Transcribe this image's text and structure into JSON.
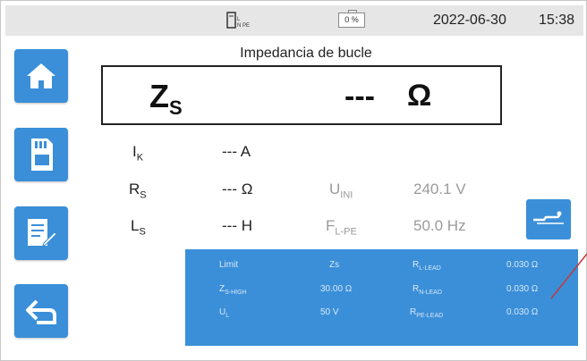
{
  "status": {
    "battery_text": "0 %",
    "date": "2022-06-30",
    "time": "15:38"
  },
  "title": "Impedancia de bucle",
  "main_result": {
    "symbol_main": "Z",
    "symbol_sub": "S",
    "value": "---",
    "unit": "Ω"
  },
  "readings": [
    {
      "sym": "I",
      "sub": "K",
      "value": "--- A"
    },
    {
      "sym": "R",
      "sub": "S",
      "value": "--- Ω"
    },
    {
      "sym": "L",
      "sub": "S",
      "value": "--- H"
    }
  ],
  "measurements": [
    {
      "sym": "U",
      "sub": "INI",
      "value": "240.1 V"
    },
    {
      "sym": "F",
      "sub": "L-PE",
      "value": "50.0 Hz"
    }
  ],
  "settings": {
    "rows": [
      {
        "c1": "Limit",
        "c1sub": "",
        "c2": "Zs",
        "c3": "R",
        "c3sub": "L-LEAD",
        "c4": "0.030 Ω"
      },
      {
        "c1": "Z",
        "c1sub": "S-HIGH",
        "c2": "30.00 Ω",
        "c3": "R",
        "c3sub": "N-LEAD",
        "c4": "0.030 Ω"
      },
      {
        "c1": "U",
        "c1sub": "L",
        "c2": "50 V",
        "c3": "R",
        "c3sub": "PE-LEAD",
        "c4": "0.030 Ω"
      }
    ]
  },
  "icons": [
    "plug-icon",
    "battery-icon",
    "home-icon",
    "memory-card-icon",
    "report-icon",
    "back-icon",
    "waveform-icon"
  ],
  "colors": {
    "accent": "#3a8fd8",
    "statusbar": "#e6e6e6"
  }
}
